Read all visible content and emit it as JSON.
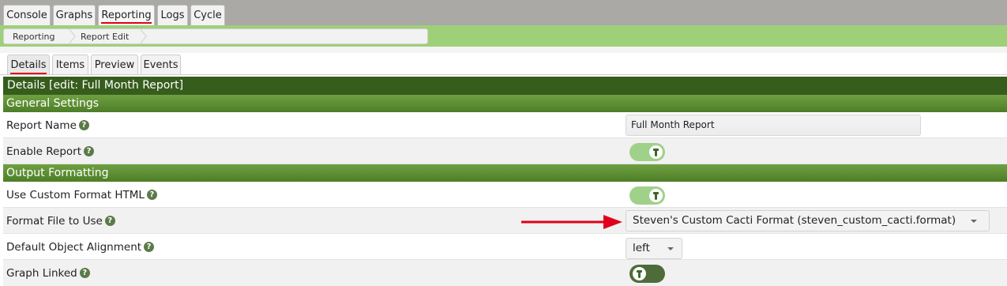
{
  "top_tabs": [
    {
      "label": "Console"
    },
    {
      "label": "Graphs"
    },
    {
      "label": "Reporting"
    },
    {
      "label": "Logs"
    },
    {
      "label": "Cycle"
    }
  ],
  "active_top_tab": "Reporting",
  "breadcrumb": [
    "Reporting",
    "Report Edit"
  ],
  "sub_tabs": [
    {
      "label": "Details"
    },
    {
      "label": "Items"
    },
    {
      "label": "Preview"
    },
    {
      "label": "Events"
    }
  ],
  "active_sub_tab": "Details",
  "panel_title": "Details [edit: Full Month Report]",
  "sections": {
    "general": "General Settings",
    "output": "Output Formatting"
  },
  "fields": {
    "report_name": {
      "label": "Report Name",
      "value": "Full Month Report"
    },
    "enable_report": {
      "label": "Enable Report",
      "state": "on"
    },
    "custom_format": {
      "label": "Use Custom Format HTML",
      "state": "on"
    },
    "format_file": {
      "label": "Format File to Use",
      "value": "Steven's Custom Cacti Format (steven_custom_cacti.format)"
    },
    "alignment": {
      "label": "Default Object Alignment",
      "value": "left"
    },
    "graph_linked": {
      "label": "Graph Linked",
      "state": "off"
    }
  },
  "help_glyph": "?",
  "icons": {
    "help": "question-circle-icon",
    "toggle_knob": "cactus-icon",
    "annotation": "red-arrow-icon"
  },
  "colors": {
    "accent_red": "#e0001b",
    "header_dark_green": "#365d1c",
    "section_green": "#5c8f33",
    "band_green": "#9ed07a",
    "toggle_on": "#a0d18a",
    "toggle_off": "#4f6b3a"
  }
}
